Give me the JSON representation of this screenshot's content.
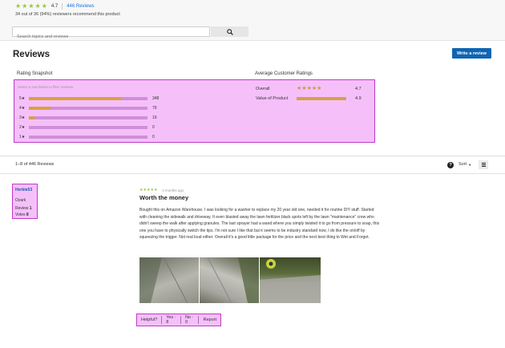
{
  "summary": {
    "average": "4.7",
    "stars_filled": 5,
    "reviews_link": "446 Reviews",
    "recommend_text": "34 out of 36 (94%) reviewers recommend this product"
  },
  "search": {
    "placeholder": "Search topics and reviews",
    "button_icon": "search-icon"
  },
  "reviews_header": {
    "title": "Reviews",
    "write_button": "Write a review"
  },
  "snapshot": {
    "title": "Rating Snapshot",
    "hint": "Select a row below to filter reviews.",
    "rows": [
      {
        "label": "5★",
        "count": "348",
        "fraction": 0.78
      },
      {
        "label": "4★",
        "count": "79",
        "fraction": 0.18
      },
      {
        "label": "3★",
        "count": "19",
        "fraction": 0.05
      },
      {
        "label": "2★",
        "count": "0",
        "fraction": 0
      },
      {
        "label": "1★",
        "count": "0",
        "fraction": 0
      }
    ]
  },
  "customer_ratings": {
    "title": "Average Customer Ratings",
    "overall_label": "Overall",
    "overall_value": "4.7",
    "value_label": "Value of Product",
    "value_value": "4.9",
    "value_fraction": 0.98
  },
  "toolbar": {
    "count_text": "1–8 of 446 Reviews",
    "help_icon": "question-icon",
    "sort_label": "Sort",
    "menu_icon": "menu-icon"
  },
  "review": {
    "author": "Herbie53",
    "location": "Ozark",
    "review_count_label": "Review",
    "review_count": "1",
    "votes_label": "Votes",
    "votes_count": "8",
    "rating": 5,
    "time_ago": "3 months ago",
    "title": "Worth the money",
    "body": "Bought this on Amazon Warehouse. I was looking for a washer to replace my 20 year old one, needed it for routine DIY stuff. Started with cleaning the sidewalk and driveway. It even blasted away the lawn fertilizer black spots left by the lawn \"maintenance\" crew who didn't sweep the walk after applying granules. The last sprayer had a wand where you simply twisted it to go from pressure to soap, this one you have to physically switch the tips. I'm not sure I like that but it seems to be industry standard now, I do like the on/off by squeezing the trigger. Not real loud either. Overall it's a good little package for the price and the next best thing to Wet and Forget.",
    "helpful_label": "Helpful?",
    "yes_label": "Yes · 8",
    "no_label": "No · 0",
    "report_label": "Report"
  },
  "colors": {
    "accent_blue": "#0f64b4",
    "star_green": "#9bc53d",
    "bar_gold": "#d9a040",
    "highlight": "#f5c0fa",
    "highlight_border": "#c03ac8"
  }
}
